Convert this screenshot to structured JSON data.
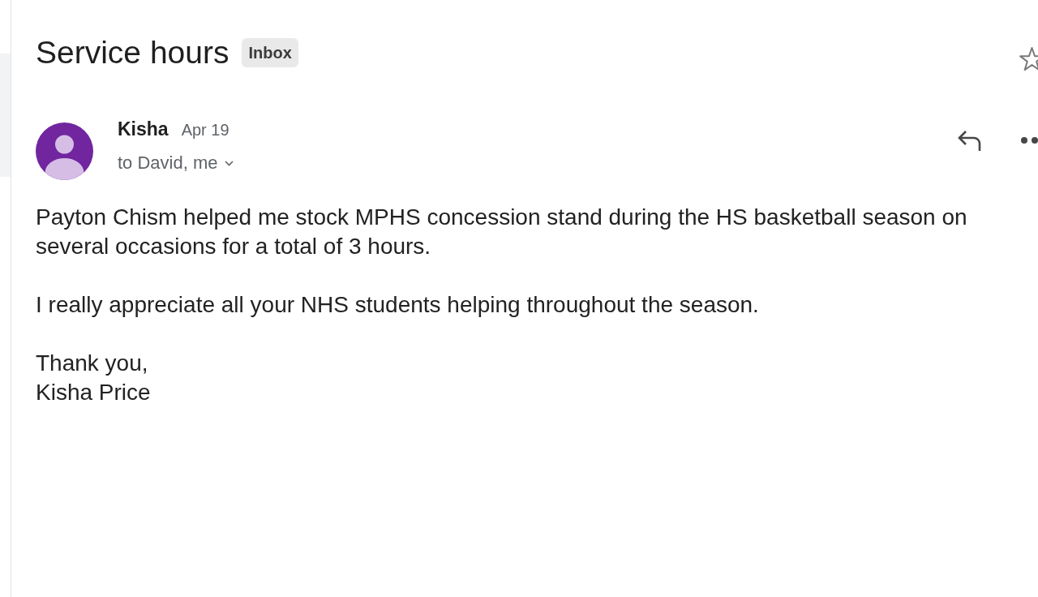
{
  "subject": "Service hours",
  "label": "Inbox",
  "starred": false,
  "message": {
    "sender": "Kisha",
    "date": "Apr 19",
    "recipients": "to David, me",
    "paragraphs": [
      "Payton Chism helped me stock MPHS concession stand during the HS basketball season on several occasions for a total of 3 hours.",
      "I really appreciate all your NHS students helping throughout the season."
    ],
    "signature": [
      "Thank you,",
      "Kisha Price"
    ]
  }
}
